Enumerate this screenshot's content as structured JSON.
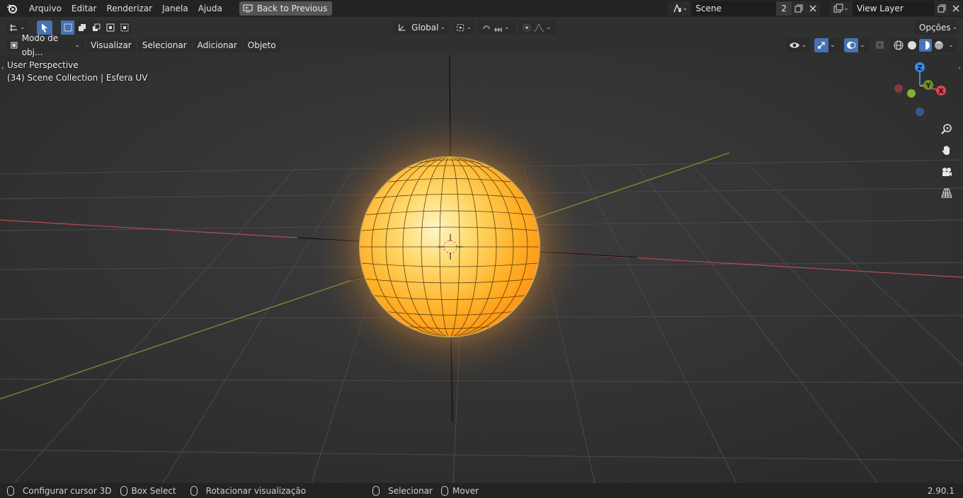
{
  "menu": {
    "items": [
      "Arquivo",
      "Editar",
      "Renderizar",
      "Janela",
      "Ajuda"
    ],
    "back_label": "Back to Previous"
  },
  "scene": {
    "name": "Scene",
    "users": "2",
    "view_layer": "View Layer"
  },
  "toolbar": {
    "orientation": "Global",
    "options_label": "Opções"
  },
  "header": {
    "mode": "Modo de obj...",
    "menus": [
      "Visualizar",
      "Selecionar",
      "Adicionar",
      "Objeto"
    ]
  },
  "viewport": {
    "perspective": "User Perspective",
    "collection": "(34) Scene Collection | Esfera UV",
    "gizmo": {
      "x": "X",
      "y": "Y",
      "z": "Z"
    }
  },
  "status": {
    "items": [
      "Configurar cursor 3D",
      "Box Select",
      "Rotacionar visualização",
      "Selecionar",
      "Mover"
    ],
    "version": "2.90.1"
  },
  "colors": {
    "x_axis": "#e0444f",
    "y_axis": "#7fb22f",
    "z_axis": "#3b8be8",
    "active_blue": "#4772b3"
  }
}
